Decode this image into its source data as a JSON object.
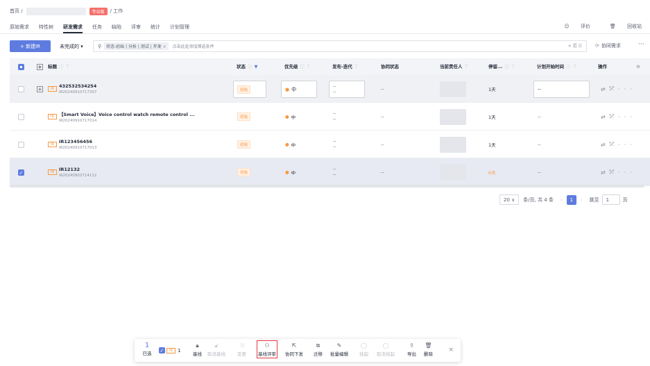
{
  "breadcrumb": {
    "home": "首页 /",
    "pro_tag": "专业版",
    "current": "/ 工作"
  },
  "tabs": [
    "原始需求",
    "特性树",
    "研发需求",
    "任务",
    "缺陷",
    "评审",
    "统计",
    "计划管理"
  ],
  "active_tab": "研发需求",
  "top_actions": {
    "rate": "评价",
    "recycle": "回收站"
  },
  "toolbar": {
    "new_button": "+ 新建IR",
    "filter_dropdown": "未完成的 ▾",
    "search_chip": "状态:初始 | 分析 | 测试 | 开发",
    "search_placeholder": "点击此处添加筛选条件",
    "search_tail": "× 🗐 ☷",
    "collab": "协同需求",
    "more": "···"
  },
  "columns": {
    "title": "标题",
    "status": "状态",
    "priority": "优先级",
    "release": "发布-迭代",
    "collab_status": "协同状态",
    "owner": "当前责任人",
    "stay": "停留...",
    "plan_start": "计划开始时间",
    "ops": "操作"
  },
  "rows": [
    {
      "tag": "IR",
      "title": "432532534254",
      "id": "IR20240910717307",
      "status": "初始",
      "priority": "中",
      "release_top": "--",
      "release_bottom": "--",
      "collab": "--",
      "stay": "1天",
      "plan_start": "--"
    },
    {
      "tag": "IR",
      "title": "【Smart Voice】Voice control watch remote control ...",
      "id": "IR20240910717014",
      "status": "初始",
      "priority": "中",
      "release_top": "--",
      "release_bottom": "--",
      "collab": "--",
      "stay": "1天",
      "plan_start": "--"
    },
    {
      "tag": "IR",
      "title": "IR123456456",
      "id": "IR20240910717013",
      "status": "初始",
      "priority": "中",
      "release_top": "--",
      "release_bottom": "--",
      "collab": "--",
      "stay": "1天",
      "plan_start": "--"
    },
    {
      "tag": "IR",
      "title": "IR12132",
      "id": "IR20240903714112",
      "status": "初始",
      "priority": "中",
      "release_top": "--",
      "release_bottom": "--",
      "collab": "--",
      "stay": "6天",
      "plan_start": "--"
    }
  ],
  "pagination": {
    "page_size": "20 ∨",
    "summary": "条/页, 共 4 条",
    "prev": "‹",
    "current": "1",
    "next": "›",
    "jump_label": "跳至",
    "jump_value": "1",
    "page_unit": "页"
  },
  "bulk_bar": {
    "count": "1",
    "selected_label": "已选",
    "chip_tag": "IR",
    "chip_count": "1",
    "actions": [
      "基线",
      "取消基线",
      "变更",
      "基线评审",
      "协同下发",
      "迁移",
      "批量编辑",
      "挂起",
      "取消挂起",
      "导出",
      "删除"
    ],
    "close": "×"
  },
  "colors": {
    "accent": "#5e7ce0",
    "warning": "#fa9841",
    "highlight": "#e0393e"
  }
}
